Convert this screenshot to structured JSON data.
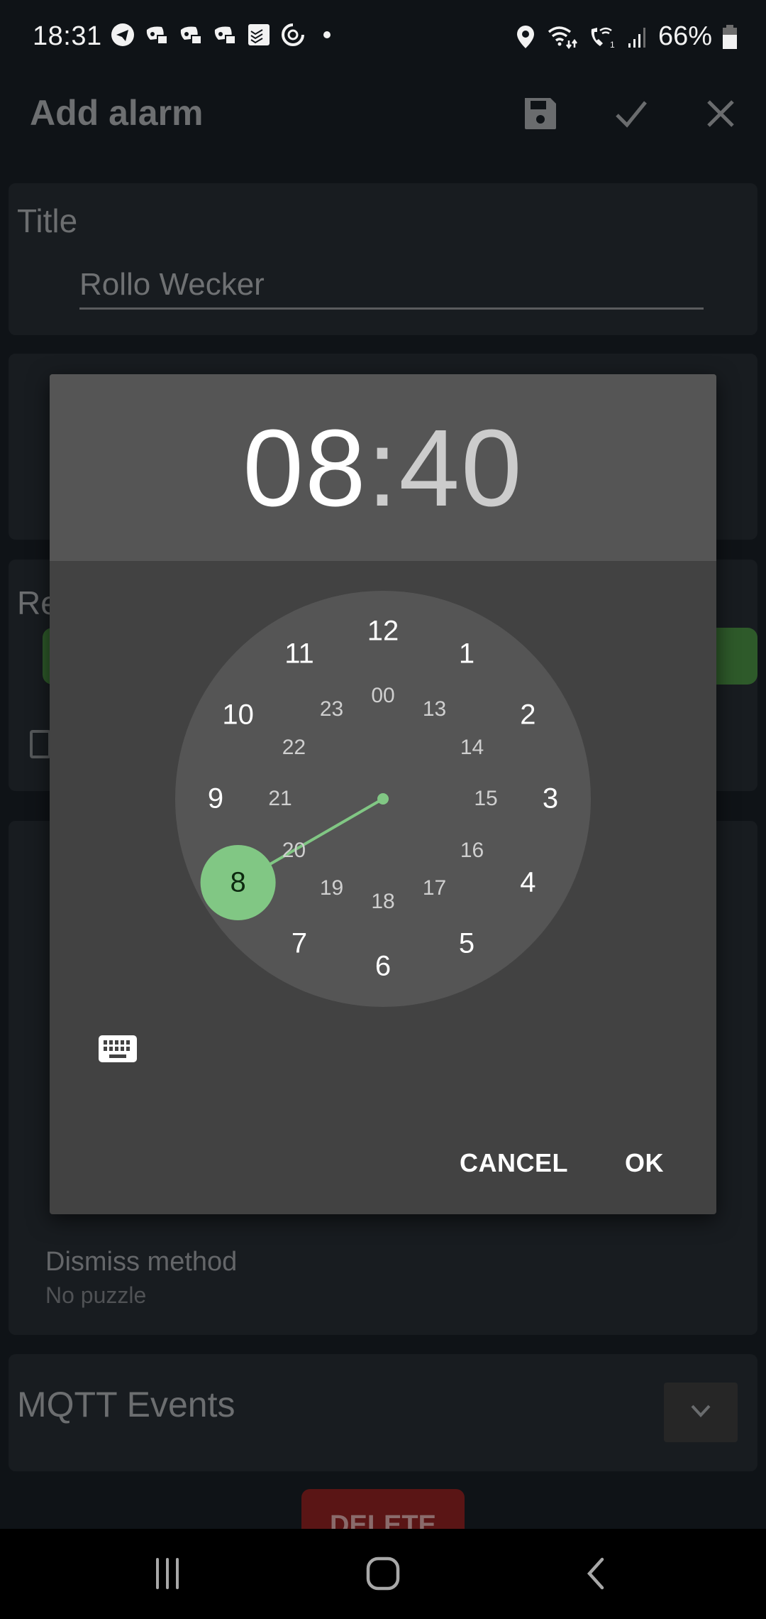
{
  "status_bar": {
    "time": "18:31",
    "notification_icons": [
      "telegram-icon",
      "discord-icon",
      "discord-icon",
      "discord-icon",
      "todoist-icon",
      "sync-icon",
      "more-dot-icon"
    ],
    "system_icons": [
      "location-icon",
      "wifi-icon",
      "wifi-calling-icon",
      "signal-icon"
    ],
    "battery_percent": "66%",
    "battery_level": 0.66
  },
  "app_bar": {
    "title": "Add alarm",
    "actions": [
      "save-icon",
      "check-icon",
      "close-icon"
    ]
  },
  "form": {
    "title_section": {
      "label": "Title",
      "value": "Rollo Wecker"
    },
    "repeat_section": {
      "label_partial": "Re"
    },
    "dismiss_section": {
      "label": "Dismiss method",
      "value": "No puzzle"
    },
    "mqtt_section": {
      "label": "MQTT Events"
    },
    "delete_label": "DELETE"
  },
  "time_picker": {
    "hours": "08",
    "separator": ":",
    "minutes": "40",
    "mode": "hour",
    "selected_hour": 8,
    "outer_ring": [
      "12",
      "1",
      "2",
      "3",
      "4",
      "5",
      "6",
      "7",
      "8",
      "9",
      "10",
      "11"
    ],
    "inner_ring": [
      "00",
      "13",
      "14",
      "15",
      "16",
      "17",
      "18",
      "19",
      "20",
      "21",
      "22",
      "23"
    ],
    "accent_color": "#81c784",
    "cancel_label": "CANCEL",
    "ok_label": "OK",
    "keyboard_toggle": "keyboard-icon"
  },
  "nav_bar": {
    "buttons": [
      "recents-icon",
      "home-icon",
      "back-icon"
    ]
  }
}
